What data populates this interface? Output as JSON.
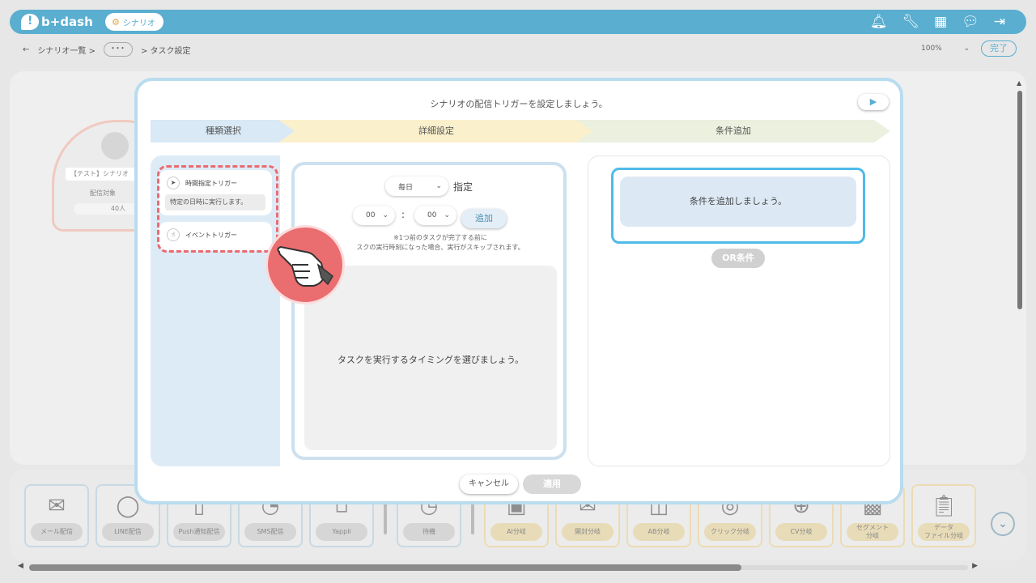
{
  "header": {
    "logo_text": "b+dash",
    "scenario_label": "シナリオ",
    "icons": [
      "bell-icon",
      "wrench-icon",
      "grid-icon",
      "chat-icon",
      "logout-icon"
    ]
  },
  "breadcrumb": {
    "back": "←",
    "list": "シナリオ一覧 >",
    "more": "･･･",
    "current": "> タスク設定"
  },
  "toolbar": {
    "zoom": "100%",
    "done": "完了"
  },
  "background_node": {
    "title": "【テスト】シナリオ",
    "target": "配信対象",
    "count": "40人"
  },
  "modal": {
    "title": "シナリオの配信トリガーを設定しましょう。",
    "steps": [
      "種類選択",
      "詳細設定",
      "条件追加"
    ],
    "triggers": {
      "time": {
        "label": "時間指定トリガー",
        "desc": "特定の日時に実行します。"
      },
      "event": {
        "label": "イベントトリガー"
      }
    },
    "detail": {
      "frequency": "毎日",
      "spec_label": "指定",
      "hour": "00",
      "minute": "00",
      "colon": ":",
      "add": "追加",
      "note1": "※1つ前のタスクが完了する前に",
      "note2": "スクの実行時刻になった場合、実行がスキップされます。",
      "timing_placeholder": "タスクを実行するタイミングを選びましょう。"
    },
    "condition": {
      "placeholder": "条件を追加しましょう。",
      "or_button": "OR条件"
    },
    "cancel": "キャンセル",
    "apply": "適用"
  },
  "palette": {
    "tiles": [
      {
        "label": "メール配信",
        "icon": "mail-icon"
      },
      {
        "label": "LINE配信",
        "icon": "line-icon"
      },
      {
        "label": "Push通知配信",
        "icon": "push-icon"
      },
      {
        "label": "SMS配信",
        "icon": "sms-icon"
      },
      {
        "label": "Yappli",
        "icon": "yappli-icon"
      },
      {
        "label": "待機",
        "icon": "timer-icon"
      },
      {
        "label": "AI分岐",
        "icon": "ai-icon"
      },
      {
        "label": "開封分岐",
        "icon": "open-mail-icon"
      },
      {
        "label": "AB分岐",
        "icon": "ab-icon"
      },
      {
        "label": "クリック分岐",
        "icon": "mouse-icon"
      },
      {
        "label": "CV分岐",
        "icon": "cv-icon"
      },
      {
        "label": "セグメント\n分岐",
        "icon": "segment-icon"
      },
      {
        "label": "データ\nファイル分岐",
        "icon": "clipboard-icon"
      }
    ]
  }
}
